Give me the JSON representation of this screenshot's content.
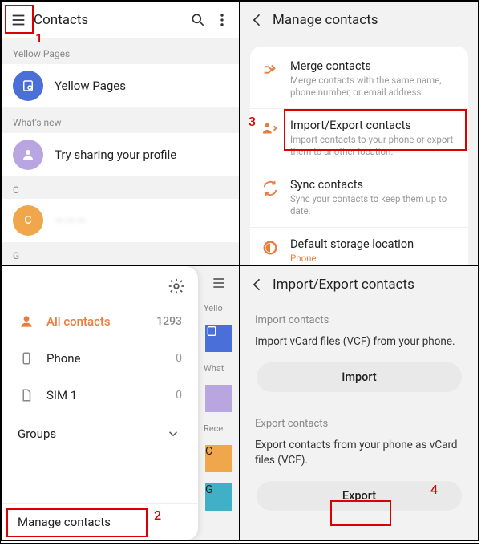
{
  "panel1": {
    "title": "Contacts",
    "sec_yellow": "Yellow Pages",
    "yellow_item": "Yellow Pages",
    "sec_whatsnew": "What's new",
    "whatsnew_item": "Try sharing your profile",
    "letters": {
      "c": "C",
      "g": "G"
    },
    "contact_c": "———",
    "contact_g": "——— ——"
  },
  "panel2": {
    "title": "Manage contacts",
    "items": [
      {
        "title": "Merge contacts",
        "sub": "Merge contacts with the same name, phone number, or email address."
      },
      {
        "title": "Import/Export contacts",
        "sub": "Import contacts to your phone or export them to another location."
      },
      {
        "title": "Sync contacts",
        "sub": "Sync your contacts to keep them up to date."
      },
      {
        "title": "Default storage location",
        "sub": "Phone"
      }
    ]
  },
  "panel3": {
    "all": "All contacts",
    "all_n": "1293",
    "phone": "Phone",
    "phone_n": "0",
    "sim": "SIM 1",
    "sim_n": "0",
    "groups": "Groups",
    "manage": "Manage contacts",
    "behind": {
      "yello": "Yello",
      "what": "What",
      "rece": "Rece",
      "c": "C",
      "g": "G"
    }
  },
  "panel4": {
    "title": "Import/Export contacts",
    "import_hdr": "Import contacts",
    "import_txt": "Import vCard files (VCF) from your phone.",
    "import_btn": "Import",
    "export_hdr": "Export contacts",
    "export_txt": "Export contacts from your phone as vCard files (VCF).",
    "export_btn": "Export"
  },
  "annot": {
    "n1": "1",
    "n2": "2",
    "n3": "3",
    "n4": "4"
  }
}
